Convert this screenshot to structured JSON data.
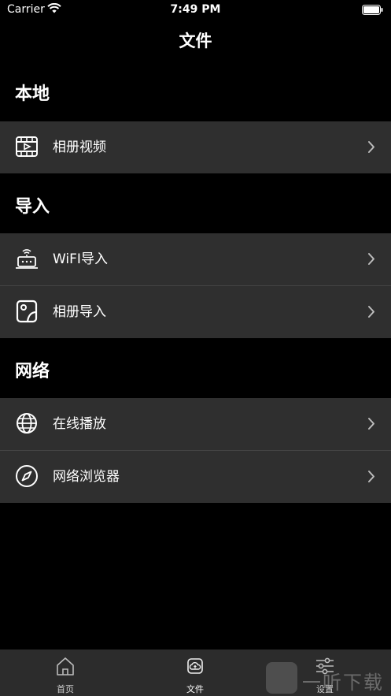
{
  "status_bar": {
    "carrier": "Carrier",
    "time": "7:49 PM"
  },
  "nav": {
    "title": "文件"
  },
  "sections": [
    {
      "header": "本地",
      "items": [
        {
          "label": "相册视频",
          "icon": "video-film-icon"
        }
      ]
    },
    {
      "header": "导入",
      "items": [
        {
          "label": "WiFI导入",
          "icon": "wifi-router-icon"
        },
        {
          "label": "相册导入",
          "icon": "photo-album-icon"
        }
      ]
    },
    {
      "header": "网络",
      "items": [
        {
          "label": "在线播放",
          "icon": "globe-icon"
        },
        {
          "label": "网络浏览器",
          "icon": "compass-icon"
        }
      ]
    }
  ],
  "tab_bar": {
    "tabs": [
      {
        "label": "首页",
        "icon": "home-icon"
      },
      {
        "label": "文件",
        "icon": "cloud-folder-icon"
      },
      {
        "label": "设置",
        "icon": "sliders-icon"
      }
    ]
  },
  "watermark": {
    "text": "一听下载"
  },
  "colors": {
    "background": "#000000",
    "cell_background": "#2f2f2f",
    "tab_bar_background": "#2c2c2c",
    "separator": "#444444"
  }
}
